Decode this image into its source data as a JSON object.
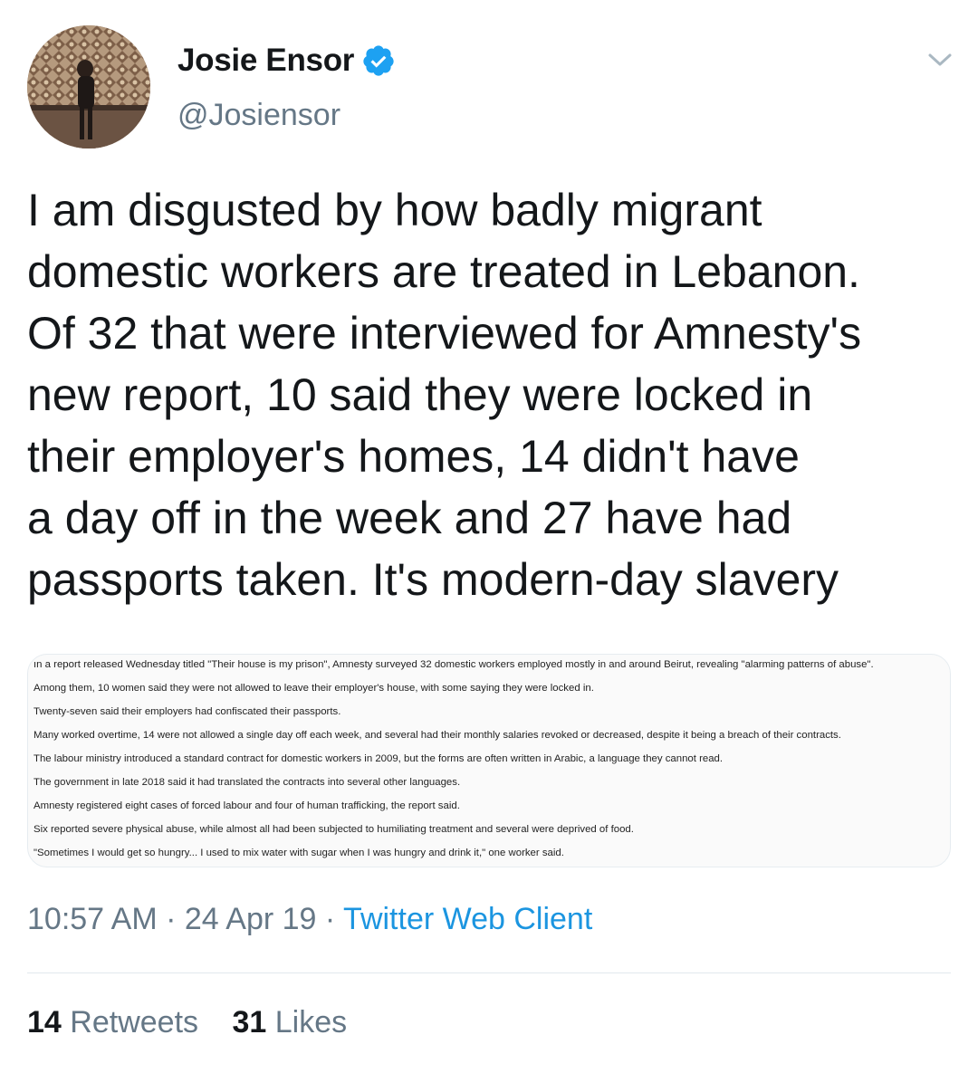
{
  "author": {
    "display_name": "Josie Ensor",
    "handle": "@Josiensor",
    "avatar_icon": "profile-photo",
    "verified_icon": "verified-badge-icon"
  },
  "colors": {
    "text": "#14171a",
    "secondary": "#657786",
    "link": "#1b95e0",
    "verified": "#1da1f2"
  },
  "tweet": {
    "lines": [
      "I am disgusted by how badly migrant",
      "domestic workers are treated in Lebanon.",
      "Of 32 that were interviewed for Amnesty's",
      "new report, 10 said they were locked in",
      "their employer's homes, 14 didn't have",
      "a day off in the week and 27 have had",
      "passports taken. It's modern-day slavery"
    ]
  },
  "attached_image": {
    "lines": [
      "ın a report released Wednesday titled \"Their house is my prison\", Amnesty surveyed 32 domestic workers employed mostly in and around Beirut, revealing \"alarming patterns of abuse\".",
      "Among them, 10 women said they were not allowed to leave their employer's house, with some saying they were locked in.",
      "Twenty-seven said their employers had confiscated their passports.",
      "Many worked overtime, 14 were not allowed a single day off each week, and several had their monthly salaries revoked or decreased, despite it being a breach of their contracts.",
      "The labour ministry introduced a standard contract for domestic workers in 2009, but the forms are often written in Arabic, a language they cannot read.",
      "The government in late 2018 said it had translated the contracts into several other languages.",
      "Amnesty registered eight cases of forced labour and four of human trafficking, the report said.",
      "Six reported severe physical abuse, while almost all had been subjected to humiliating treatment and several were deprived of food.",
      "\"Sometimes I would get so hungry... I used to mix water with sugar when I was hungry and drink it,\" one worker said."
    ]
  },
  "meta": {
    "time": "10:57 AM",
    "separator": " · ",
    "date": "24 Apr 19",
    "source": "Twitter Web Client"
  },
  "stats": {
    "retweets_count": "14",
    "retweets_label": "Retweets",
    "likes_count": "31",
    "likes_label": "Likes"
  }
}
